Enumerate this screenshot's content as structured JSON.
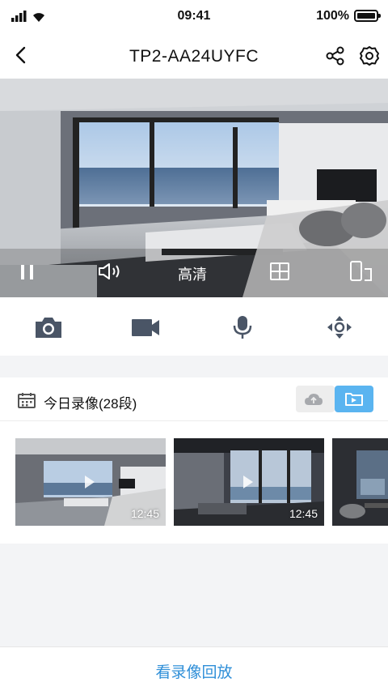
{
  "status_bar": {
    "time": "09:41",
    "battery": "100%"
  },
  "nav": {
    "title": "TP2-AA24UYFC",
    "back_icon": "back-chevron-icon",
    "share_icon": "share-icon",
    "settings_icon": "gear-icon"
  },
  "video": {
    "quality_label": "高清",
    "controls": [
      "pause-icon",
      "speaker-icon",
      "split-screen-icon",
      "rotate-phone-icon"
    ]
  },
  "toolbar": {
    "items": [
      "camera-icon",
      "video-record-icon",
      "microphone-icon",
      "ptz-direction-icon"
    ]
  },
  "recordings": {
    "title": "今日录像(28段)",
    "cloud_icon": "cloud-icon",
    "local_icon": "folder-icon",
    "active_color": "#5ab4f0",
    "clips": [
      {
        "time": "12:45"
      },
      {
        "time": "12:45"
      },
      {
        "time": ""
      }
    ]
  },
  "footer": {
    "link": "看录像回放"
  },
  "colors": {
    "accent": "#2f8fd8"
  }
}
